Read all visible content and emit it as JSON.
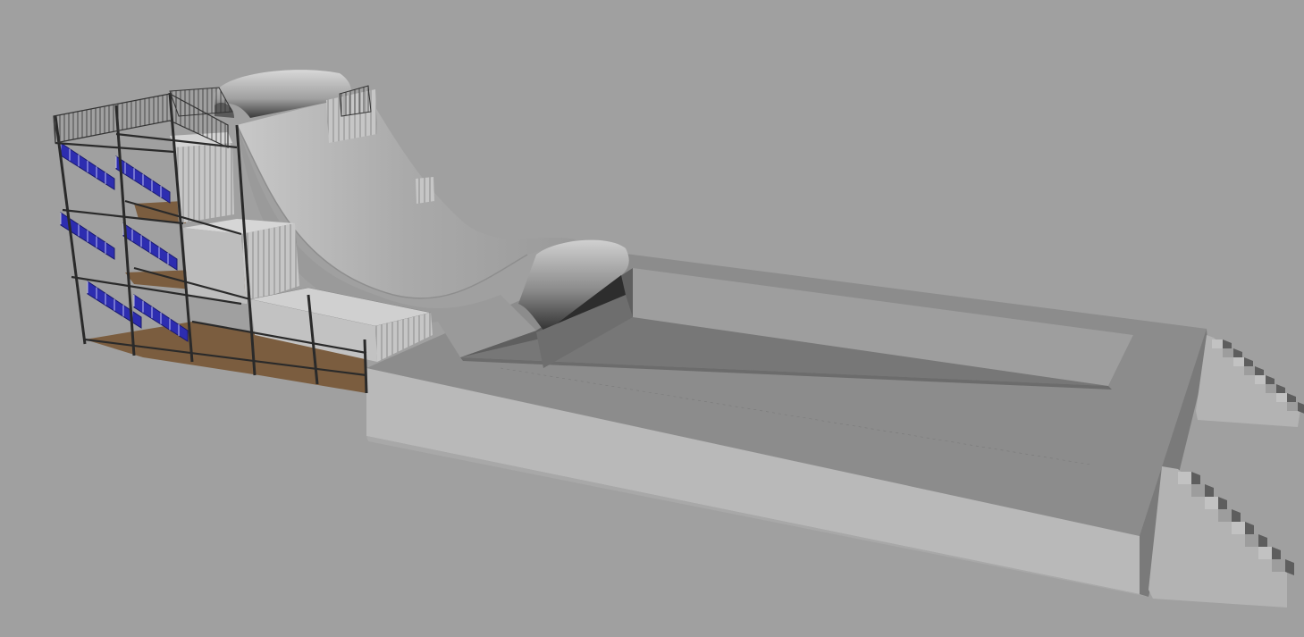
{
  "scene": {
    "background_color": "#a0a0a0",
    "colors": {
      "platform_top": "#8a8a8a",
      "platform_front": "#b9b9b9",
      "platform_side": "#7e7e7e",
      "basin_floor": "#767676",
      "basin_wall_back": "#9c9c9c",
      "basin_wall_left": "#6a6a6a",
      "ramp_surface": "#b2b2b2",
      "ramp_shadow": "#8c8c8c",
      "lip_dark": "#3a3a3a",
      "container_side": "#c4c4c4",
      "container_shade": "#9a9a9a",
      "frame_metal": "#2a2a2a",
      "stair_blue": "#2d2db0",
      "floor_wood": "#7a5c3e",
      "stair_concrete": "#b0b0b0",
      "stair_shade": "#6e6e6e"
    },
    "icons": {
      "scaffold": "scaffold-tower-icon",
      "ramp": "wave-ramp-icon",
      "pool": "landing-pool-icon",
      "stairs": "concrete-stairs-icon"
    }
  }
}
